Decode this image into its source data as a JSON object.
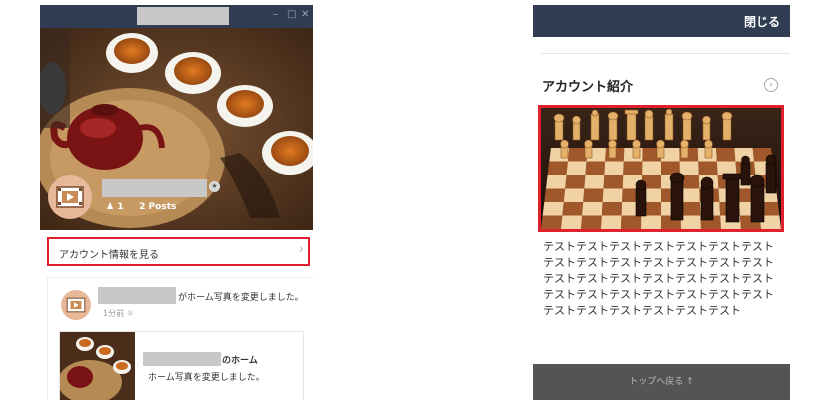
{
  "left_panel": {
    "window_controls": {
      "minimize": "–",
      "maximize": "□",
      "close": "✕"
    },
    "profile": {
      "followers_icon": "person-icon",
      "followers_count": "1",
      "posts": "2 Posts",
      "badge_icon": "shield-icon"
    },
    "account_info_label": "アカウント情報を見る",
    "account_info_chevron": "›",
    "feed": {
      "action_text": "がホーム写真を変更しました。",
      "time": "1分前",
      "globe_icon": "globe-icon",
      "inner_title": "のホーム",
      "inner_subtitle": "ホーム写真を変更しました。"
    }
  },
  "right_panel": {
    "close_label": "閉じる",
    "section_title": "アカウント紹介",
    "section_icon": "chevron-right-circle-icon",
    "section_icon_glyph": "›",
    "intro_text": "テストテストテストテストテストテストテストテストテストテストテストテストテストテストテストテストテストテストテストテストテストテストテストテストテストテストテストテストテストテストテストテストテストテスト",
    "back_to_top": "トップへ戻る ↑"
  },
  "colors": {
    "header": "#2f3c52",
    "highlight": "#e0202c",
    "footer": "#545454"
  }
}
